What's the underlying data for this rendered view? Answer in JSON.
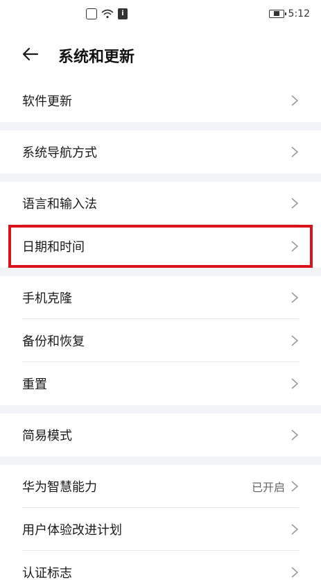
{
  "status_bar": {
    "time": "5:12",
    "notification_icon_label": "i"
  },
  "header": {
    "title": "系统和更新"
  },
  "groups": [
    {
      "items": [
        {
          "label": "软件更新"
        }
      ]
    },
    {
      "items": [
        {
          "label": "系统导航方式"
        }
      ]
    },
    {
      "items": [
        {
          "label": "语言和输入法"
        },
        {
          "label": "日期和时间"
        }
      ]
    },
    {
      "items": [
        {
          "label": "手机克隆"
        },
        {
          "label": "备份和恢复"
        },
        {
          "label": "重置"
        }
      ]
    },
    {
      "items": [
        {
          "label": "简易模式"
        }
      ]
    },
    {
      "items": [
        {
          "label": "华为智慧能力",
          "trailing": "已开启"
        },
        {
          "label": "用户体验改进计划"
        },
        {
          "label": "认证标志"
        }
      ]
    }
  ]
}
